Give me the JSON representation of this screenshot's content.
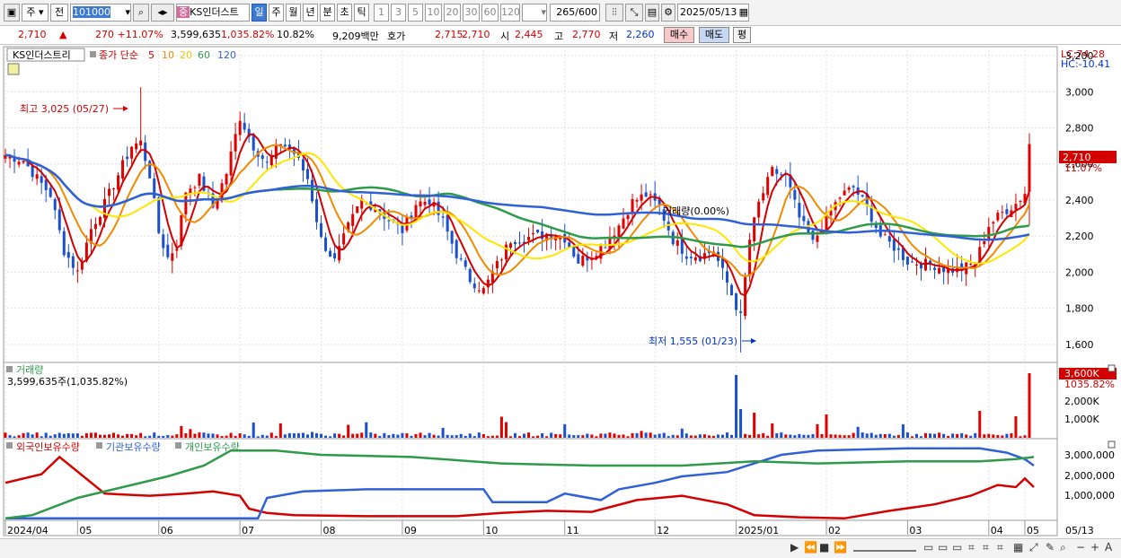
{
  "toolbar": {
    "market_type": "주",
    "price_type": "전",
    "code": "101000",
    "stock_badge": "중",
    "stock_name": "KS인더스트",
    "periods": [
      "일",
      "주",
      "월",
      "년",
      "분",
      "초",
      "틱"
    ],
    "active_period": "일",
    "intervals": [
      "1",
      "3",
      "5",
      "10",
      "20",
      "30",
      "60",
      "120"
    ],
    "count": "265",
    "count_max": "/600",
    "date": "2025/05/13"
  },
  "info": {
    "price": "2,710",
    "change": "270 +11.07%",
    "volume": "3,599,635",
    "volume_ratio": "1,035.82%",
    "turnover": "10.82%",
    "amount": "9,209백만",
    "quote_label": "호가",
    "ask": "2,715",
    "bid": "2,710",
    "open_label": "시",
    "open": "2,445",
    "high_label": "고",
    "high": "2,770",
    "low_label": "저",
    "low": "2,260",
    "buy_label": "매수",
    "sell_label": "매도",
    "avg_label": "평"
  },
  "legend": {
    "stock_name": "KS인더스트리",
    "ma_label": "종가 단순",
    "ma_periods": [
      "5",
      "10",
      "20",
      "60",
      "120"
    ],
    "ma_colors": [
      "#d40000",
      "#f08a00",
      "#ffe600",
      "#2e9a4a",
      "#3060d8"
    ],
    "high_annotation": "최고 3,025 (05/27)",
    "low_annotation": "최저 1,555 (01/23)",
    "mid_annotation": "거래량(0.00%)"
  },
  "price_axis": {
    "lc": "LC:74.28",
    "hc": "HC:-10.41",
    "ticks": [
      "3,200",
      "3,000",
      "2,800",
      "2,600",
      "2,400",
      "2,200",
      "2,000",
      "1,800",
      "1,600"
    ],
    "current": "2,710",
    "current_pct": "11.07%"
  },
  "volume_panel": {
    "title": "거래량",
    "value": "3,599,635주(1,035.82%)",
    "ticks": [
      "2,000K",
      "1,000K"
    ],
    "current": "3,600K",
    "current_pct": "1035.82%"
  },
  "holdings_panel": {
    "labels": [
      "외국인보유수량",
      "기관보유수량",
      "개인보유수량"
    ],
    "colors": [
      "#d40000",
      "#3060d8",
      "#2e9a4a"
    ],
    "ticks": [
      "3,000,000",
      "2,000,000",
      "1,000,000"
    ]
  },
  "x_axis": {
    "labels": [
      "2024/04",
      "05",
      "06",
      "07",
      "08",
      "09",
      "10",
      "11",
      "12",
      "2025/01",
      "02",
      "03",
      "04",
      "05"
    ],
    "right_label": "05/13"
  },
  "chart_data": {
    "type": "candlestick",
    "ylim": [
      1500,
      3250
    ],
    "moving_averages": [
      5,
      10,
      20,
      60,
      120
    ],
    "high": {
      "value": 3025,
      "date": "05/27"
    },
    "low": {
      "value": 1555,
      "date": "01/23"
    },
    "last": {
      "open": 2445,
      "high": 2770,
      "low": 2260,
      "close": 2710,
      "volume": 3599635
    },
    "close_anchors": [
      [
        0,
        2650
      ],
      [
        4,
        2620
      ],
      [
        7,
        2520
      ],
      [
        10,
        2430
      ],
      [
        13,
        2120
      ],
      [
        16,
        2000
      ],
      [
        19,
        2240
      ],
      [
        22,
        2380
      ],
      [
        25,
        2540
      ],
      [
        28,
        2700
      ],
      [
        30,
        2720
      ],
      [
        32,
        2540
      ],
      [
        34,
        2220
      ],
      [
        36,
        2080
      ],
      [
        38,
        2150
      ],
      [
        40,
        2450
      ],
      [
        43,
        2520
      ],
      [
        46,
        2360
      ],
      [
        49,
        2550
      ],
      [
        52,
        2860
      ],
      [
        55,
        2700
      ],
      [
        58,
        2600
      ],
      [
        61,
        2720
      ],
      [
        64,
        2660
      ],
      [
        67,
        2520
      ],
      [
        70,
        2180
      ],
      [
        73,
        2060
      ],
      [
        76,
        2250
      ],
      [
        79,
        2400
      ],
      [
        82,
        2360
      ],
      [
        85,
        2290
      ],
      [
        88,
        2230
      ],
      [
        91,
        2380
      ],
      [
        94,
        2400
      ],
      [
        97,
        2280
      ],
      [
        100,
        2100
      ],
      [
        103,
        1960
      ],
      [
        106,
        1900
      ],
      [
        109,
        2040
      ],
      [
        112,
        2180
      ],
      [
        115,
        2190
      ],
      [
        118,
        2200
      ],
      [
        121,
        2220
      ],
      [
        124,
        2190
      ],
      [
        127,
        2060
      ],
      [
        130,
        2100
      ],
      [
        133,
        2160
      ],
      [
        136,
        2260
      ],
      [
        139,
        2390
      ],
      [
        142,
        2430
      ],
      [
        145,
        2360
      ],
      [
        148,
        2180
      ],
      [
        151,
        2100
      ],
      [
        154,
        2090
      ],
      [
        157,
        2120
      ],
      [
        160,
        1940
      ],
      [
        163,
        1750
      ],
      [
        165,
        2180
      ],
      [
        167,
        2380
      ],
      [
        170,
        2560
      ],
      [
        173,
        2530
      ],
      [
        176,
        2300
      ],
      [
        179,
        2160
      ],
      [
        182,
        2300
      ],
      [
        185,
        2420
      ],
      [
        188,
        2470
      ],
      [
        191,
        2360
      ],
      [
        194,
        2200
      ],
      [
        197,
        2140
      ],
      [
        200,
        2060
      ],
      [
        203,
        2050
      ],
      [
        206,
        2040
      ],
      [
        209,
        2010
      ],
      [
        212,
        2020
      ],
      [
        215,
        2050
      ],
      [
        218,
        2260
      ],
      [
        221,
        2330
      ],
      [
        224,
        2380
      ],
      [
        226,
        2440
      ],
      [
        227,
        2710
      ]
    ],
    "holdings": {
      "foreign": [
        [
          0,
          1700000
        ],
        [
          8,
          2100000
        ],
        [
          12,
          2900000
        ],
        [
          22,
          1200000
        ],
        [
          32,
          1100000
        ],
        [
          40,
          1200000
        ],
        [
          46,
          1300000
        ],
        [
          52,
          1100000
        ],
        [
          54,
          500000
        ],
        [
          58,
          300000
        ],
        [
          64,
          200000
        ],
        [
          80,
          150000
        ],
        [
          100,
          150000
        ],
        [
          110,
          300000
        ],
        [
          120,
          400000
        ],
        [
          130,
          350000
        ],
        [
          140,
          900000
        ],
        [
          150,
          1100000
        ],
        [
          160,
          700000
        ],
        [
          166,
          200000
        ],
        [
          176,
          100000
        ],
        [
          186,
          50000
        ],
        [
          196,
          400000
        ],
        [
          206,
          700000
        ],
        [
          214,
          1100000
        ],
        [
          220,
          1600000
        ],
        [
          224,
          1500000
        ],
        [
          226,
          1900000
        ],
        [
          228,
          1500000
        ]
      ],
      "institution": [
        [
          0,
          50000
        ],
        [
          30,
          50000
        ],
        [
          56,
          50000
        ],
        [
          58,
          1000000
        ],
        [
          66,
          1300000
        ],
        [
          80,
          1400000
        ],
        [
          106,
          1400000
        ],
        [
          108,
          800000
        ],
        [
          120,
          800000
        ],
        [
          124,
          1200000
        ],
        [
          132,
          900000
        ],
        [
          136,
          1400000
        ],
        [
          144,
          1700000
        ],
        [
          150,
          2000000
        ],
        [
          160,
          2200000
        ],
        [
          166,
          2600000
        ],
        [
          172,
          3000000
        ],
        [
          180,
          3200000
        ],
        [
          200,
          3300000
        ],
        [
          216,
          3300000
        ],
        [
          222,
          3100000
        ],
        [
          226,
          2800000
        ],
        [
          228,
          2500000
        ]
      ],
      "individual": [
        [
          0,
          50000
        ],
        [
          6,
          200000
        ],
        [
          16,
          1000000
        ],
        [
          26,
          1500000
        ],
        [
          36,
          2000000
        ],
        [
          44,
          2500000
        ],
        [
          50,
          3200000
        ],
        [
          60,
          3200000
        ],
        [
          70,
          3000000
        ],
        [
          90,
          2900000
        ],
        [
          110,
          2600000
        ],
        [
          130,
          2500000
        ],
        [
          150,
          2500000
        ],
        [
          166,
          2700000
        ],
        [
          180,
          2600000
        ],
        [
          200,
          2700000
        ],
        [
          216,
          2700000
        ],
        [
          224,
          2800000
        ],
        [
          228,
          2900000
        ]
      ]
    },
    "holdings_ylim": [
      0,
      3500000
    ]
  }
}
